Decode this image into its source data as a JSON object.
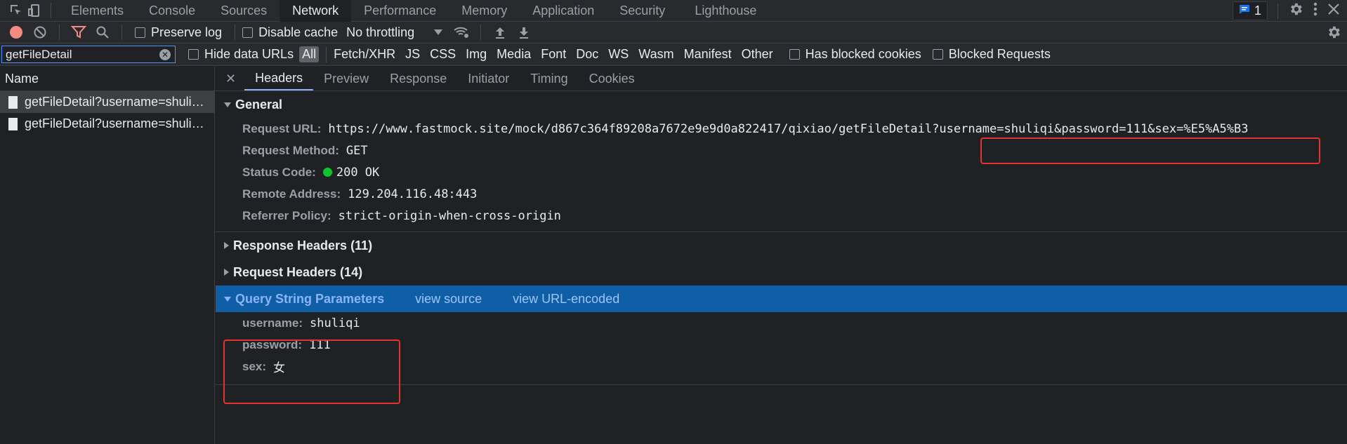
{
  "top_tabs": [
    "Elements",
    "Console",
    "Sources",
    "Network",
    "Performance",
    "Memory",
    "Application",
    "Security",
    "Lighthouse"
  ],
  "active_tab": "Network",
  "issues_count": "1",
  "toolbar": {
    "preserve_log": "Preserve log",
    "disable_cache": "Disable cache",
    "throttling": "No throttling"
  },
  "filter": {
    "value": "getFileDetail",
    "hide_data_urls": "Hide data URLs",
    "types": [
      "All",
      "Fetch/XHR",
      "JS",
      "CSS",
      "Img",
      "Media",
      "Font",
      "Doc",
      "WS",
      "Wasm",
      "Manifest",
      "Other"
    ],
    "has_blocked_cookies": "Has blocked cookies",
    "blocked_requests": "Blocked Requests"
  },
  "requests": {
    "header": "Name",
    "items": [
      "getFileDetail?username=shuli…",
      "getFileDetail?username=shuli…"
    ]
  },
  "detail_tabs": [
    "Headers",
    "Preview",
    "Response",
    "Initiator",
    "Timing",
    "Cookies"
  ],
  "general": {
    "title": "General",
    "request_url_label": "Request URL:",
    "request_url_base": "https://www.fastmock.site/mock/d867c364f89208a7672e9e9d0a822417/qixiao/getFileDetail?",
    "request_url_query": "username=shuliqi&password=111&sex=%E5%A5%B3",
    "method_label": "Request Method:",
    "method": "GET",
    "status_label": "Status Code:",
    "status": "200 OK",
    "remote_label": "Remote Address:",
    "remote": "129.204.116.48:443",
    "referrer_label": "Referrer Policy:",
    "referrer": "strict-origin-when-cross-origin"
  },
  "response_headers": "Response Headers (11)",
  "request_headers": "Request Headers (14)",
  "query": {
    "title": "Query String Parameters",
    "view_source": "view source",
    "view_encoded": "view URL-encoded",
    "params": [
      {
        "key": "username:",
        "value": "shuliqi"
      },
      {
        "key": "password:",
        "value": "111"
      },
      {
        "key": "sex:",
        "value": "女"
      }
    ]
  },
  "colors": {
    "accent": "#0f5fa6",
    "highlight": "#e3342f",
    "status_ok": "#0fc42e"
  }
}
